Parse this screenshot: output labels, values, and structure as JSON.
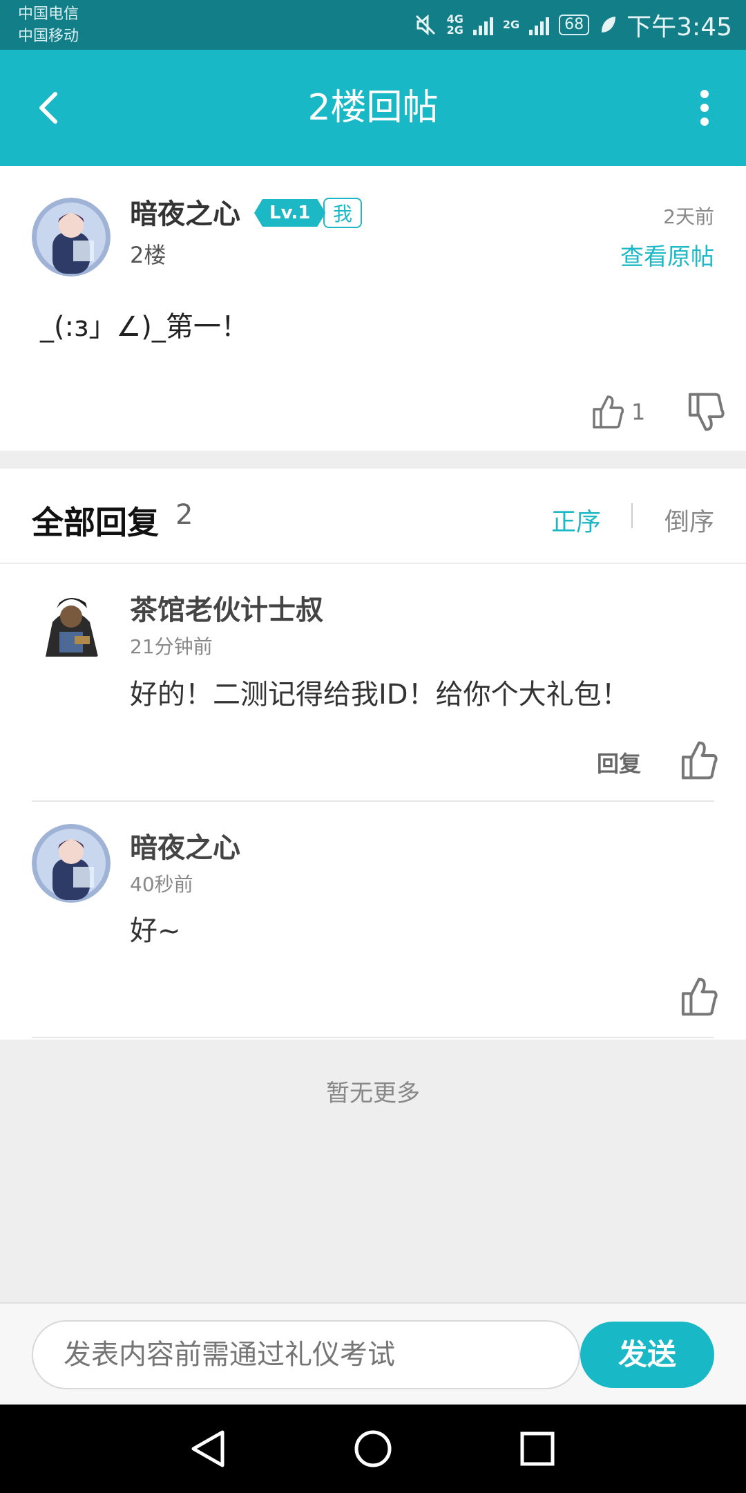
{
  "status_bar": {
    "carrier1": "中国电信",
    "carrier2": "中国移动",
    "network_a": "4G",
    "network_b": "2G",
    "network_c": "2G",
    "battery": "68",
    "time": "下午3:45"
  },
  "header": {
    "title": "2楼回帖",
    "back_icon": "back-arrow-icon",
    "more_icon": "more-vertical-icon"
  },
  "post": {
    "author": "暗夜之心",
    "level": "Lv.1",
    "me_badge": "我",
    "time": "2天前",
    "floor": "2楼",
    "view_original": "查看原帖",
    "content": "_(:з」∠)_第一！",
    "likes": "1"
  },
  "replies_header": {
    "title": "全部回复",
    "count": "2",
    "sort_asc": "正序",
    "sort_desc": "倒序"
  },
  "replies": [
    {
      "author": "茶馆老伙计士叔",
      "time": "21分钟前",
      "text": "好的！二测记得给我ID！给你个大礼包！",
      "reply_label": "回复"
    },
    {
      "author": "暗夜之心",
      "time": "40秒前",
      "text": "好~"
    }
  ],
  "footer": {
    "no_more": "暂无更多"
  },
  "input_bar": {
    "placeholder": "发表内容前需通过礼仪考试",
    "send": "发送"
  },
  "colors": {
    "accent": "#18b8c6",
    "status_bar": "#127e87"
  }
}
